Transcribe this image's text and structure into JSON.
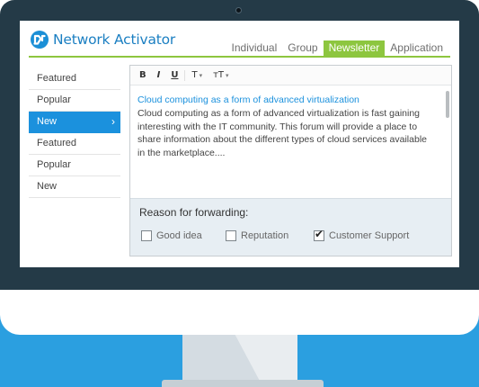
{
  "app": {
    "name": "Network Activator",
    "logo_icon": "logo-n-icon"
  },
  "tabs": [
    {
      "label": "Individual",
      "active": false
    },
    {
      "label": "Group",
      "active": false
    },
    {
      "label": "Newsletter",
      "active": true
    },
    {
      "label": "Application",
      "active": false
    }
  ],
  "nav": {
    "items": [
      {
        "label": "Featured",
        "active": false
      },
      {
        "label": "Popular",
        "active": false
      },
      {
        "label": "New",
        "active": true,
        "chevron": "›"
      },
      {
        "label": "Featured",
        "active": false
      },
      {
        "label": "Popular",
        "active": false
      },
      {
        "label": "New",
        "active": false
      }
    ]
  },
  "toolbar": {
    "bold": "B",
    "italic": "I",
    "underline": "U",
    "text_style": "T",
    "text_size": "тT",
    "caret": "▾"
  },
  "post": {
    "title": "Cloud computing as a form of advanced virtualization",
    "body": "Cloud computing as a form of advanced virtualization is fast gaining interesting with the IT community. This forum will provide a place to share information about the different types of cloud services available in the marketplace...."
  },
  "forwarding": {
    "title": "Reason for forwarding:",
    "options": [
      {
        "label": "Good idea",
        "checked": false
      },
      {
        "label": "Reputation",
        "checked": false
      },
      {
        "label": "Customer Support",
        "checked": true,
        "mark": "✔"
      }
    ]
  },
  "colors": {
    "accent_green": "#8dc63f",
    "accent_blue": "#1b91dd",
    "bezel": "#243a47",
    "floor": "#2b9fe0"
  }
}
